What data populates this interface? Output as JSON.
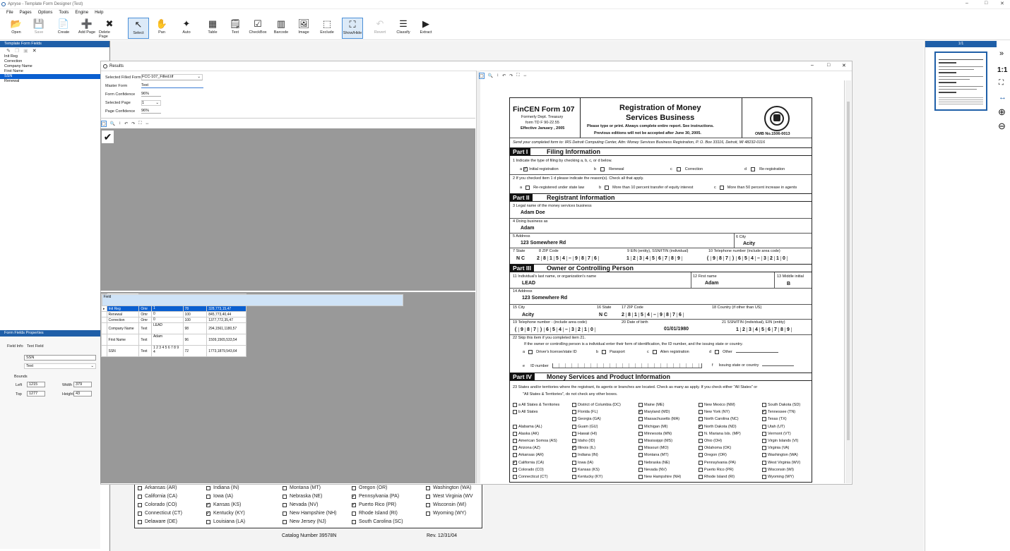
{
  "app": {
    "title": "Apryse - Template Form Designer (Test)",
    "window_controls": [
      "–",
      "□",
      "✕"
    ]
  },
  "menu": [
    "File",
    "Pages",
    "Options",
    "Tools",
    "Engine",
    "Help"
  ],
  "toolbar": [
    {
      "label": "Open",
      "icon": "open-folder-icon",
      "glyph": "📂",
      "state": "normal"
    },
    {
      "label": "Save",
      "icon": "save-icon",
      "glyph": "💾",
      "state": "disabled"
    },
    {
      "label": "Create",
      "icon": "create-icon",
      "glyph": "📄",
      "state": "normal"
    },
    {
      "label": "Add Page",
      "icon": "add-page-icon",
      "glyph": "➕",
      "state": "normal"
    },
    {
      "label": "Delete Page",
      "icon": "delete-page-icon",
      "glyph": "✖",
      "state": "normal"
    },
    {
      "label": "Select",
      "icon": "cursor-icon",
      "glyph": "↖",
      "state": "selected"
    },
    {
      "label": "Pan",
      "icon": "hand-icon",
      "glyph": "✋",
      "state": "normal"
    },
    {
      "label": "Auto",
      "icon": "sparkle-icon",
      "glyph": "✦",
      "state": "normal"
    },
    {
      "label": "Table",
      "icon": "table-icon",
      "glyph": "▦",
      "state": "normal"
    },
    {
      "label": "Text",
      "icon": "text-icon",
      "glyph": "🗒",
      "state": "normal"
    },
    {
      "label": "CheckBox",
      "icon": "checkbox-icon",
      "glyph": "☑",
      "state": "normal"
    },
    {
      "label": "Barcode",
      "icon": "barcode-icon",
      "glyph": "▥",
      "state": "normal"
    },
    {
      "label": "Image",
      "icon": "image-icon",
      "glyph": "🖼",
      "state": "normal"
    },
    {
      "label": "Exclude",
      "icon": "exclude-icon",
      "glyph": "⬚",
      "state": "normal"
    },
    {
      "label": "Show/Hide",
      "icon": "show-hide-icon",
      "glyph": "⛶",
      "state": "selected"
    },
    {
      "label": "Revert",
      "icon": "revert-icon",
      "glyph": "↶",
      "state": "disabled"
    },
    {
      "label": "Classify",
      "icon": "classify-icon",
      "glyph": "☰",
      "state": "normal"
    },
    {
      "label": "Extract",
      "icon": "play-icon",
      "glyph": "▶",
      "state": "normal"
    }
  ],
  "left_panel": {
    "title": "Template Form Fields",
    "fields": [
      "Init Reg",
      "Correction",
      "Company Name",
      "First Name",
      "SSN",
      "Renewal"
    ],
    "selected_index": 4
  },
  "props": {
    "title": "Form Fields Properties",
    "tabs": [
      "Field Info",
      "Text Field"
    ],
    "name": "SSN",
    "type": "Text",
    "bounds_label": "Bounds",
    "left_label": "Left",
    "left": "1215",
    "top_label": "Top",
    "top": "1277",
    "width_label": "Width",
    "width": "379",
    "height_label": "Height",
    "height": "43"
  },
  "results": {
    "title": "Results",
    "selected_filled_form_label": "Selected Filled Form",
    "selected_filled_form": "FCC-107_Filled.tif",
    "master_form_label": "Master Form",
    "master_form": "Test",
    "form_confidence_label": "Form Confidence",
    "form_confidence": "96%",
    "selected_page_label": "Selected Page",
    "selected_page": "1",
    "page_confidence_label": "Page Confidence",
    "page_confidence": "96%",
    "preview_glyph": "✔",
    "table": {
      "headers": [
        "Field",
        "Type",
        "Result",
        "Confidence",
        "Bounding Rectangle"
      ],
      "rows": [
        [
          "Init Reg",
          "Omr",
          "1",
          "78",
          "328,773,15,47"
        ],
        [
          "Renewal",
          "Omr",
          "0",
          "100",
          "845,773,40,44"
        ],
        [
          "Correction",
          "Omr",
          "0",
          "100",
          "1377,772,35,47"
        ],
        [
          "Company Name",
          "Text",
          "LEAD",
          "98",
          "294,1561,1180,57"
        ],
        [
          "First Name",
          "Text",
          "Adam",
          "96",
          "1509,1565,533,54"
        ],
        [
          "SSN",
          "Text",
          "1 2 3 4 5 6 7 8 9 4",
          "72",
          "1773,1879,543,64"
        ]
      ],
      "selected_row": 0
    }
  },
  "thumb": {
    "page_label": "1/1"
  },
  "rail": {
    "collapse": "»",
    "one_to_one": "1:1",
    "fit": "⛶",
    "fit_width": "↔",
    "zoom_in": "⊕",
    "zoom_out": "⊖"
  },
  "form": {
    "header": {
      "form_name": "FinCEN Form 107",
      "formerly": "Formerly Dept. Treasury",
      "td": "form TD F 90-22.55",
      "effective": "Effective January , 2005",
      "title1": "Registration of Money",
      "title2": "Services Business",
      "instr1": "Please type or print.  Always complete entire report.  See instructions.",
      "instr2": "Previous editions will not be accepted after June 30, 2005.",
      "omb": "OMB No.1506-0013"
    },
    "send_to": "Send your completed form to: IRS Detroit Computing Center,  Attn: Money Services Business Registration,  P. O. Box 33116,  Detroit, MI 48232-0116",
    "part1": {
      "num": "Part I",
      "title": "Filing Information",
      "l1": "1  Indicate the type of filing by checking a, b, c, or d below.",
      "a": "Initial registration",
      "b": "Renewal",
      "c": "Correction",
      "d": "Re-registration",
      "l2": "2  If you checked item 1 d  please indicate the reason(s).  Check all that apply.",
      "r_a": "Re-registered under state law",
      "r_b": "More than 10 percent transfer of equity interest",
      "r_c": "More than 50 percent increase in agents"
    },
    "part2": {
      "num": "Part II",
      "title": "Registrant Information",
      "l3": "3  Legal name of the money services business",
      "v3": "Adam Doe",
      "l4": "4  Doing business as",
      "v4": "Adam",
      "l5": "5  Address",
      "v5": "123 Somewhere Rd",
      "l6": "6  City",
      "v6": "Acity",
      "l7": "7  State",
      "v7": "N C",
      "l8": "8  ZIP Code",
      "v8": [
        "2",
        "8",
        "1",
        "5",
        "4",
        "–",
        "9",
        "8",
        "7",
        "6"
      ],
      "l9": "9  EIN (entity), SSN/ITIN (individual)",
      "v9": [
        "1",
        "2",
        "3",
        "4",
        "5",
        "6",
        "7",
        "8",
        "9"
      ],
      "l10": "10  Telephone number (include area code)",
      "v10": [
        "(",
        "9",
        "8",
        "7",
        ")",
        "6",
        "5",
        "4",
        "–",
        "3",
        "2",
        "1",
        "0"
      ]
    },
    "part3": {
      "num": "Part III",
      "title": "Owner or Controlling Person",
      "l11": "11  Individual's last name, or organization's name",
      "v11": "LEAD",
      "l12": "12  First name",
      "v12": "Adam",
      "l13": "13  Middle initial",
      "v13": "B",
      "l14": "14  Address",
      "v14": "123 Somewhere Rd",
      "l15": "15  City",
      "v15": "Acity",
      "l16": "16  State",
      "v16": "N C",
      "l17": "17  ZIP Code",
      "v17": [
        "2",
        "8",
        "1",
        "5",
        "4",
        "–",
        "9",
        "8",
        "7",
        "6"
      ],
      "l18": "18  Country (if other than US)",
      "l19": "19  Telephone number - (include area code)",
      "v19": [
        "(",
        "9",
        "8",
        "7",
        ")",
        "6",
        "5",
        "4",
        "–",
        "3",
        "2",
        "1",
        "0"
      ],
      "l20": "20  Date of birth",
      "v20": "01/01/1980",
      "l21": "21  SSN/ITIN (individual), EIN (entity)",
      "v21": [
        "1",
        "2",
        "3",
        "4",
        "5",
        "6",
        "7",
        "8",
        "9"
      ],
      "l22": "22  Skip this item if you completed item 21.",
      "l22b": "If the owner or controlling person is a individual enter their form of identification, the ID number, and the issuing state or country.",
      "id_a": "Driver's license/state ID",
      "id_b": "Passport",
      "id_c": "Alien registration",
      "id_d": "Other",
      "id_e": "ID number",
      "id_f": "Issuing state or country"
    },
    "part4": {
      "num": "Part IV",
      "title": "Money Services and Product Information",
      "l23": "23  States and/or territories where the registrant, its agents or branches are located.  Check as many as apply.  If you check either \"All States\" or",
      "l23b": "\"All States & Territories\", do not check any other boxes.",
      "states": [
        [
          {
            "t": "a  All States & Territories",
            "c": false
          },
          {
            "t": "b  All States",
            "c": false
          },
          {
            "t": "",
            "c": false
          },
          {
            "t": "Alabama (AL)",
            "c": false
          },
          {
            "t": "Alaska (AK)",
            "c": false
          },
          {
            "t": "American Somoa (AS)",
            "c": false
          },
          {
            "t": "Arizona (AZ)",
            "c": false
          },
          {
            "t": "Arkansas (AR)",
            "c": false
          },
          {
            "t": "California (CA)",
            "c": true
          },
          {
            "t": "Colorado (CO)",
            "c": false
          },
          {
            "t": "Connecticut (CT)",
            "c": false
          }
        ],
        [
          {
            "t": "District of Columbia (DC)",
            "c": false
          },
          {
            "t": "Florida (FL)",
            "c": false
          },
          {
            "t": "Georgia (GA)",
            "c": false
          },
          {
            "t": "Guam (GU)",
            "c": false
          },
          {
            "t": "Hawaii (HI)",
            "c": false
          },
          {
            "t": "Idaho (ID)",
            "c": false
          },
          {
            "t": "Illinois (IL)",
            "c": true
          },
          {
            "t": "Indiana (IN)",
            "c": false
          },
          {
            "t": "Iowa (IA)",
            "c": false
          },
          {
            "t": "Kansas (KS)",
            "c": false
          },
          {
            "t": "Kentucky (KY)",
            "c": false
          }
        ],
        [
          {
            "t": "Maine (ME)",
            "c": false
          },
          {
            "t": "Maryland (MD)",
            "c": true
          },
          {
            "t": "Massachusetts (MA)",
            "c": false
          },
          {
            "t": "Michigan (MI)",
            "c": false
          },
          {
            "t": "Minnesota (MN)",
            "c": false
          },
          {
            "t": "Mississippi (MS)",
            "c": false
          },
          {
            "t": "Missouri (MO)",
            "c": false
          },
          {
            "t": "Montana (MT)",
            "c": false
          },
          {
            "t": "Nebraska (NE)",
            "c": false
          },
          {
            "t": "Nevada (NV)",
            "c": false
          },
          {
            "t": "New Hampshire (NH)",
            "c": false
          }
        ],
        [
          {
            "t": "New Mexico (NM)",
            "c": false
          },
          {
            "t": "New York (NY)",
            "c": false
          },
          {
            "t": "North Carolina (NC)",
            "c": false
          },
          {
            "t": "North Dakota (ND)",
            "c": true
          },
          {
            "t": "N. Mariana Isls. (MP)",
            "c": false
          },
          {
            "t": "Ohio (OH)",
            "c": false
          },
          {
            "t": "Oklahoma (OK)",
            "c": false
          },
          {
            "t": "Oregon (OR)",
            "c": false
          },
          {
            "t": "Pennsylvania (PA)",
            "c": false
          },
          {
            "t": "Puerto Rico (PR)",
            "c": false
          },
          {
            "t": "Rhode Island (RI)",
            "c": false
          }
        ],
        [
          {
            "t": "South Dakota (SD)",
            "c": false
          },
          {
            "t": "Tennessee (TN)",
            "c": true
          },
          {
            "t": "Texas (TX)",
            "c": false
          },
          {
            "t": "Utah (UT)",
            "c": false
          },
          {
            "t": "Vermont (VT)",
            "c": false
          },
          {
            "t": "Virgin Islands (VI)",
            "c": false
          },
          {
            "t": "Virginia (VA)",
            "c": false
          },
          {
            "t": "Washington (WA)",
            "c": false
          },
          {
            "t": "West Virginia (WV)",
            "c": false
          },
          {
            "t": "Wisconsin (WI)",
            "c": false
          },
          {
            "t": "Wyoming (WY)",
            "c": false
          }
        ]
      ]
    }
  },
  "bg_page": {
    "states": [
      [
        {
          "t": "Arkansas (AR)",
          "c": false
        },
        {
          "t": "California (CA)",
          "c": false
        },
        {
          "t": "Colorado (CO)",
          "c": false
        },
        {
          "t": "Connecticut (CT)",
          "c": false
        },
        {
          "t": "Delaware (DE)",
          "c": false
        }
      ],
      [
        {
          "t": "Indiana (IN)",
          "c": false
        },
        {
          "t": "Iowa (IA)",
          "c": false
        },
        {
          "t": "Kansas (KS)",
          "c": true
        },
        {
          "t": "Kentucky (KY)",
          "c": true
        },
        {
          "t": "Louisiana (LA)",
          "c": false
        }
      ],
      [
        {
          "t": "Montana (MT)",
          "c": false
        },
        {
          "t": "Nebraska (NE)",
          "c": false
        },
        {
          "t": "Nevada (NV)",
          "c": false
        },
        {
          "t": "New Hampshire (NH)",
          "c": false
        },
        {
          "t": "New Jersey (NJ)",
          "c": false
        }
      ],
      [
        {
          "t": "Oregon (OR)",
          "c": false
        },
        {
          "t": "Pennsylvania (PA)",
          "c": true
        },
        {
          "t": "Puerto Rico (PR)",
          "c": true
        },
        {
          "t": "Rhode Island (RI)",
          "c": false
        },
        {
          "t": "South Carolina (SC)",
          "c": false
        }
      ],
      [
        {
          "t": "Washington (WA)",
          "c": false
        },
        {
          "t": "West Virginia (WV",
          "c": false
        },
        {
          "t": "Wisconsin (WI)",
          "c": false
        },
        {
          "t": "Wyoming (WY)",
          "c": false
        }
      ]
    ],
    "catalog": "Catalog Number 39578N",
    "rev": "Rev. 12/31/04"
  }
}
